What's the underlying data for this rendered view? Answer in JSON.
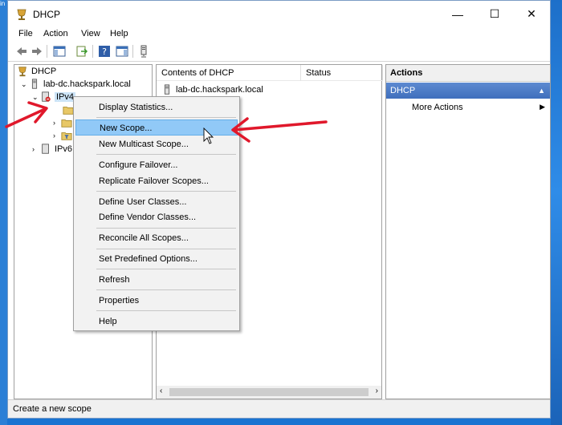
{
  "desktop": {
    "corner_text": "in"
  },
  "window": {
    "title": "DHCP",
    "controls": {
      "minimize": "—",
      "maximize": "☐",
      "close": "✕"
    }
  },
  "menu": [
    "File",
    "Action",
    "View",
    "Help"
  ],
  "tree": {
    "root": "DHCP",
    "server": "lab-dc.hackspark.local",
    "ipv4": "IPv4",
    "ipv4_children": [
      "S",
      "",
      "I"
    ],
    "ipv6": "IPv6"
  },
  "center": {
    "columns": [
      "Contents of DHCP",
      "Status"
    ],
    "rows": [
      "lab-dc.hackspark.local"
    ]
  },
  "actions": {
    "header": "Actions",
    "group": "DHCP",
    "items": [
      "More Actions"
    ]
  },
  "context_menu": {
    "items": [
      "Display Statistics...",
      "New Scope...",
      "New Multicast Scope...",
      "Configure Failover...",
      "Replicate Failover Scopes...",
      "Define User Classes...",
      "Define Vendor Classes...",
      "Reconcile All Scopes...",
      "Set Predefined Options...",
      "Refresh",
      "Properties",
      "Help"
    ],
    "highlighted": "New Scope..."
  },
  "status_bar": "Create a new scope",
  "colors": {
    "annotation_arrow": "#e0182b",
    "menu_highlight": "#91c9f7",
    "actions_group": "#4a7cc7"
  }
}
